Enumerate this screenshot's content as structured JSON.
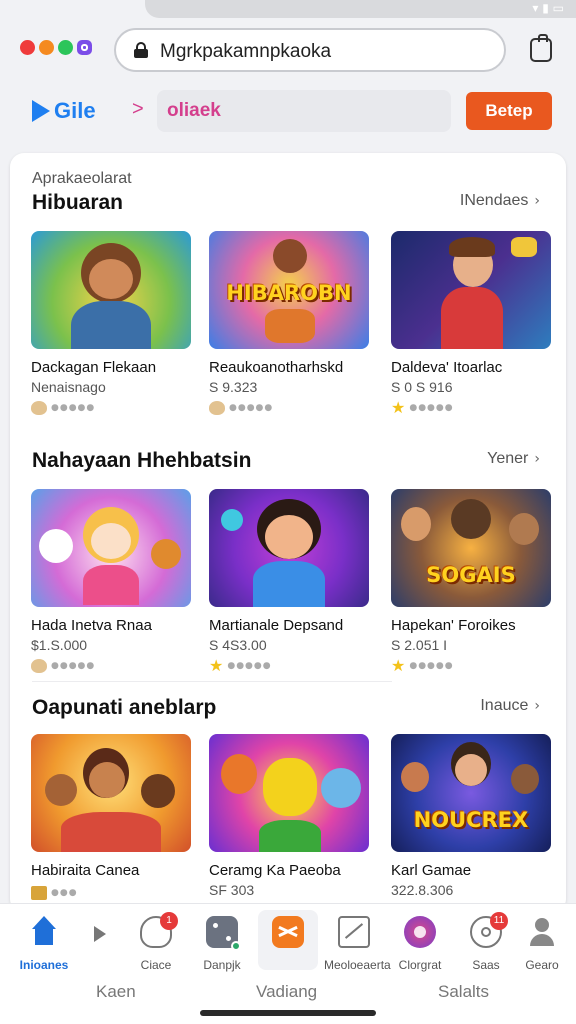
{
  "browser": {
    "url": "Mgrkpakamnpkaoka"
  },
  "topnav": {
    "logo_text": "Gile",
    "search_value": "oliaek",
    "cta_label": "Betep"
  },
  "content": {
    "eyebrow": "Aprakaeolarat",
    "sections": [
      {
        "title": "Hibuaran",
        "more": "INendaes",
        "games": [
          {
            "name": "Dackagan Flekaan",
            "sub": "Nenaisnago",
            "rating_icon": "cookie-badge"
          },
          {
            "name": "Reaukoanotharhskd",
            "sub": "S 9.323",
            "rating_icon": "cookie-badge",
            "thumb_title": "HIBAROBN"
          },
          {
            "name": "Daldeva' Itoarlac",
            "sub": "S 0 S 916",
            "rating_icon": "star"
          }
        ]
      },
      {
        "title": "Nahayaan Hhehbatsin",
        "more": "Yener",
        "games": [
          {
            "name": "Hada Inetva Rnaa",
            "sub": "$1.S.000",
            "rating_icon": "cookie-badge"
          },
          {
            "name": "Martianale Depsand",
            "sub": "S 4S3.00",
            "rating_icon": "star"
          },
          {
            "name": "Hapekan' Foroikes",
            "sub": "S 2.051 I",
            "rating_icon": "star",
            "thumb_title": "SOGAIS"
          }
        ]
      },
      {
        "title": "Oapunati aneblarp",
        "more": "Inauce",
        "games": [
          {
            "name": "Habiraita Canea",
            "sub": "",
            "rating_icon": "square-badge"
          },
          {
            "name": "Ceramg Ka Paeoba",
            "sub": "SF 303",
            "rating_icon": "none"
          },
          {
            "name": "Karl Gamae",
            "sub": "322.8.306",
            "rating_icon": "none",
            "thumb_title": "NOUCREX"
          }
        ]
      }
    ]
  },
  "tabbar": {
    "tabs": [
      {
        "label": "Inioanes",
        "icon": "home-icon",
        "active": true
      },
      {
        "label": "Ciace",
        "icon": "controller-icon",
        "badge": "1"
      },
      {
        "label": "Danpjk",
        "icon": "dice-icon"
      },
      {
        "label": "",
        "icon": "shuffle-icon"
      },
      {
        "label": "Meoloeaerta",
        "icon": "box-icon"
      },
      {
        "label": "Clorgrat",
        "icon": "shield-icon"
      },
      {
        "label": "Saas",
        "icon": "gear-icon",
        "badge": "11"
      },
      {
        "label": "Gearo",
        "icon": "profile-icon"
      }
    ],
    "bottom_labels": [
      "Kaen",
      "Vadiang",
      "Salalts"
    ]
  },
  "colors": {
    "accent": "#1f7ff0",
    "cta": "#e9581f",
    "search_text": "#d43f8d"
  }
}
